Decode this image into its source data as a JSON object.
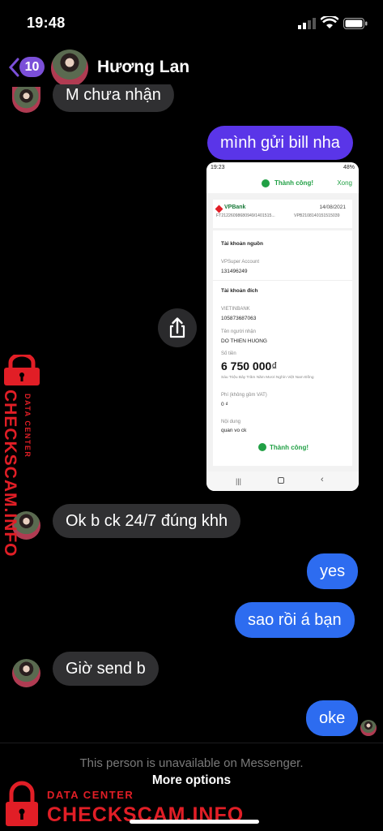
{
  "status_bar": {
    "time": "19:48"
  },
  "header": {
    "back_count": "10",
    "contact_name": "Hương Lan"
  },
  "messages": [
    {
      "text": "M chưa nhận"
    },
    {
      "text": "mình gửi bill nha"
    },
    {
      "text": "Ok b ck 24/7 đúng khh"
    },
    {
      "text": "yes"
    },
    {
      "text": "sao rồi á bạn"
    },
    {
      "text": "Giờ send b"
    },
    {
      "text": "oke"
    }
  ],
  "receipt": {
    "status_time": "19:23",
    "status_batt": "48%",
    "success_top": "Thành công!",
    "close": "Xong",
    "bank": "VPBank",
    "date": "14/08/2021",
    "ref1": "FT21226098680949/1401515...",
    "ref2": "VPB2108140151515039",
    "src_title": "Tài khoản nguồn",
    "src_label": "VPSuper Account",
    "src_number": "131496249",
    "dst_title": "Tài khoản đích",
    "dst_bank": "VIETINBANK",
    "dst_number": "105873687063",
    "receiver_label": "Tên người nhận",
    "receiver_name": "DO THIEN HUONG",
    "amount_label": "Số tiền",
    "amount": "6 750 000",
    "currency": "₫",
    "amount_words": "Sáu Triệu Bảy Trăm Năm Mươi Nghìn Việt Nam Đồng",
    "fee_label": "Phí (không gồm VAT)",
    "fee": "0 ₫",
    "content_label": "Nội dung",
    "content": "quan vo ck",
    "success_bottom": "Thành công!"
  },
  "watermark": {
    "brand": "CHECKSCAM.INFO",
    "sub": "DATA CENTER",
    "color": "#e11e26"
  },
  "footer": {
    "unavailable": "This person is unavailable on Messenger.",
    "more_options": "More options"
  },
  "colors": {
    "outgoing_purple": "#5a35e8",
    "outgoing_blue": "#2d6cf0",
    "incoming": "#303032",
    "accent": "#7b4fd8"
  },
  "icons": [
    "back-chevron-icon",
    "share-icon",
    "signal-icon",
    "wifi-icon",
    "battery-icon",
    "lock-icon"
  ]
}
